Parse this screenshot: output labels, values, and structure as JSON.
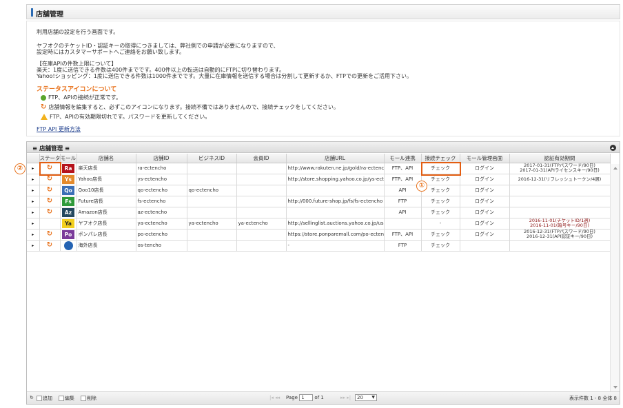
{
  "header": {
    "title": "店舗管理"
  },
  "info": {
    "intro": "利用店舗の設定を行う画面です。",
    "yahoo_line1": "ヤフオクのチケットID・認証キーの取得につきましては、弊社側での申請が必要になりますので、",
    "yahoo_line2": "設定時にはカスタマーサポートへご連絡をお願い致します。",
    "limit_title": "【在庫APIの件数上限について】",
    "limit_rakuten": "楽天：1度に送信できる件数は400件までです。400件以上の転送は自動的にFTPに切り替わります。",
    "limit_yahoo": "Yahoo!ショッピング：1度に送信できる件数は1000件までです。大量に在庫情報を送信する場合は分割して更新するか、FTPでの更新をご活用下さい。",
    "status_title": "ステータスアイコンについて",
    "status_ok": "FTP、APIの接続が正常です。",
    "status_sync": "店舗情報を編集すると、必ずこのアイコンになります。接続不備ではありませんので、接続チェックをしてください。",
    "status_warn": "FTP、APIの有効期限切れです。パスワードを更新してください。",
    "link": "FTP API 更新方法"
  },
  "grid": {
    "title": "≡ 店舗管理 ≡",
    "columns": [
      "",
      "ステータス",
      "モール",
      "店舗名",
      "店舗ID",
      "ビジネスID",
      "会員ID",
      "店舗URL",
      "モール連携",
      "接続チェック",
      "モール管理画面",
      "認証有効期間"
    ],
    "rows": [
      {
        "mall": "Ra",
        "mall_color": "#b5121b",
        "name": "楽天店長",
        "shop_id": "ra-ectencho",
        "biz_id": "",
        "member_id": "",
        "url": "http://www.rakuten.ne.jp/gold/ra-ectencho",
        "link": "FTP、API",
        "check": "チェック",
        "admin": "ログイン",
        "expiry": [
          "2017-01-31(FTPパスワード/90日)",
          "2017-01-31(APIライセンスキー/90日)"
        ],
        "expiry_red": false,
        "status": "sync"
      },
      {
        "mall": "Ys",
        "mall_color": "#e48a2b",
        "name": "Yahoo店長",
        "shop_id": "ys-ectencho",
        "biz_id": "",
        "member_id": "",
        "url": "http://store.shopping.yahoo.co.jp/ys-ectencho",
        "link": "FTP、API",
        "check": "チェック",
        "admin": "ログイン",
        "expiry": [
          "2016-12-31(リフレッシュトークン/4週)"
        ],
        "expiry_red": false,
        "status": "sync"
      },
      {
        "mall": "Qo",
        "mall_color": "#3b6fb6",
        "name": "Qoo10店長",
        "shop_id": "qo-ectencho",
        "biz_id": "qo-ectencho",
        "member_id": "",
        "url": "",
        "link": "API",
        "check": "チェック",
        "admin": "ログイン",
        "expiry": [],
        "expiry_red": false,
        "status": "sync"
      },
      {
        "mall": "Fs",
        "mall_color": "#2f9a3a",
        "name": "Future店長",
        "shop_id": "fs-ectencho",
        "biz_id": "",
        "member_id": "",
        "url": "http://000.future-shop.jp/fs/fs-ectencho",
        "link": "FTP",
        "check": "チェック",
        "admin": "ログイン",
        "expiry": [],
        "expiry_red": false,
        "status": "sync"
      },
      {
        "mall": "Az",
        "mall_color": "#24485e",
        "name": "Amazon店長",
        "shop_id": "az-ectencho",
        "biz_id": "",
        "member_id": "",
        "url": "",
        "link": "API",
        "check": "チェック",
        "admin": "ログイン",
        "expiry": [],
        "expiry_red": false,
        "status": "sync"
      },
      {
        "mall": "Ya",
        "mall_color": "#f2cf1e",
        "name": "ヤフオク店長",
        "shop_id": "ya-ectencho",
        "biz_id": "ya-ectencho",
        "member_id": "ya-ectencho",
        "url": "http://sellinglist.auctions.yahoo.co.jp/user/ya-ectencho",
        "link": "",
        "check": "-",
        "admin": "ログイン",
        "expiry": [
          "2016-11-01(チケットID/1週)",
          "2016-11-01(暗号キー/90日)"
        ],
        "expiry_red": true,
        "status": ""
      },
      {
        "mall": "Po",
        "mall_color": "#7b3b9a",
        "name": "ポンパレ店長",
        "shop_id": "po-ectencho",
        "biz_id": "",
        "member_id": "",
        "url": "https://store.ponparemall.com/po-ectencho",
        "link": "FTP、API",
        "check": "チェック",
        "admin": "ログイン",
        "expiry": [
          "2016-12-31(FTPパスワード/90日)",
          "2016-12-31(API認証キー/90日)"
        ],
        "expiry_red": false,
        "status": "sync"
      },
      {
        "mall": "",
        "mall_color": "#2463b3",
        "name": "海外店長",
        "shop_id": "os-tencho",
        "biz_id": "",
        "member_id": "",
        "url": "-",
        "link": "FTP",
        "check": "チェック",
        "admin": "",
        "expiry": [],
        "expiry_red": false,
        "status": "sync"
      }
    ]
  },
  "pager": {
    "add": "追加",
    "edit": "編集",
    "delete": "削除",
    "page_label": "Page",
    "page_value": "1",
    "of_label": "of 1",
    "per_page": "20",
    "summary": "表示件数 1 - 8 全体 8"
  },
  "annotations": {
    "one": "①",
    "two": "②"
  },
  "colors": {
    "accent": "#e8711a",
    "highlight": "#e35d11"
  }
}
